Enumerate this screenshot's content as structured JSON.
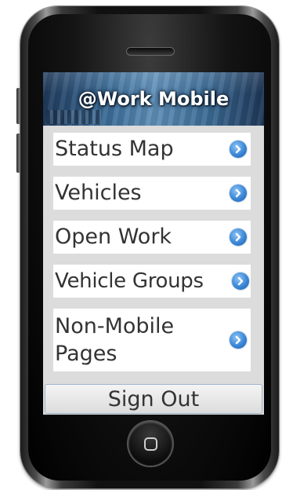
{
  "app": {
    "title": "@Work Mobile"
  },
  "menu": {
    "items": [
      {
        "label": "Status Map",
        "icon": "chevron-right-circle-icon"
      },
      {
        "label": "Vehicles",
        "icon": "chevron-right-circle-icon"
      },
      {
        "label": "Open Work",
        "icon": "chevron-right-circle-icon"
      },
      {
        "label": "Vehicle Groups",
        "icon": "chevron-right-circle-icon"
      },
      {
        "label": "Non-Mobile Pages",
        "icon": "chevron-right-circle-icon"
      }
    ]
  },
  "footer": {
    "signout_label": "Sign Out"
  },
  "colors": {
    "accent_chevron": "#3a86d6",
    "banner": "#3d6e99",
    "menu_text": "#333333",
    "screen_background": "#dcdcdc"
  }
}
